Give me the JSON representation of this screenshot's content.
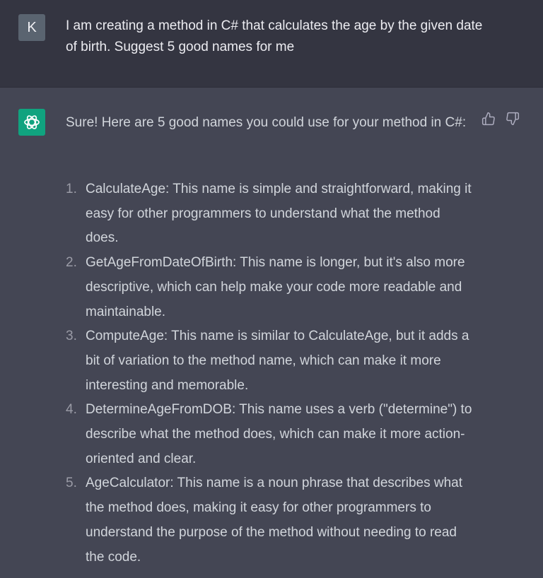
{
  "user_message": {
    "avatar_letter": "K",
    "text": "I am creating a method in C# that calculates the age by the given date of birth. Suggest 5 good names for me"
  },
  "assistant_message": {
    "intro": "Sure! Here are 5 good names you could use for your method in C#:",
    "items": [
      {
        "number": "1.",
        "text": "CalculateAge: This name is simple and straightforward, making it easy for other programmers to understand what the method does."
      },
      {
        "number": "2.",
        "text": "GetAgeFromDateOfBirth: This name is longer, but it's also more descriptive, which can help make your code more readable and maintainable."
      },
      {
        "number": "3.",
        "text": "ComputeAge: This name is similar to CalculateAge, but it adds a bit of variation to the method name, which can make it more interesting and memorable."
      },
      {
        "number": "4.",
        "text": "DetermineAgeFromDOB: This name uses a verb (\"determine\") to describe what the method does, which can make it more action-oriented and clear."
      },
      {
        "number": "5.",
        "text": "AgeCalculator: This name is a noun phrase that describes what the method does, making it easy for other programmers to understand the purpose of the method without needing to read the code."
      }
    ]
  },
  "icons": {
    "assistant_avatar": "openai-logo-icon",
    "thumbs_up": "thumbs-up-icon",
    "thumbs_down": "thumbs-down-icon"
  },
  "colors": {
    "user_bg": "#343541",
    "assistant_bg": "#444654",
    "assistant_avatar_bg": "#10a37f",
    "text": "#d1d5db"
  }
}
